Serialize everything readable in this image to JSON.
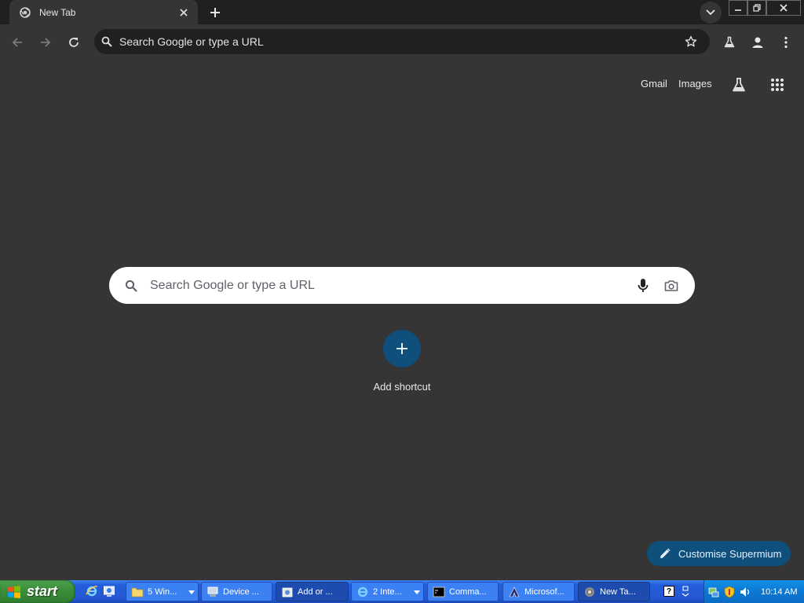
{
  "browser": {
    "tab": {
      "title": "New Tab",
      "favicon": "chrome-icon"
    },
    "omnibox": {
      "placeholder": "Search Google or type a URL"
    }
  },
  "page": {
    "top_links": {
      "gmail": "Gmail",
      "images": "Images"
    },
    "search": {
      "placeholder": "Search Google or type a URL"
    },
    "shortcut": {
      "label": "Add shortcut"
    },
    "customise": {
      "label": "Customise Supermium"
    }
  },
  "taskbar": {
    "start_label": "start",
    "buttons": [
      {
        "label": "5 Win...",
        "icon": "folder-icon",
        "grouped": true
      },
      {
        "label": "Device ...",
        "icon": "device-manager-icon",
        "grouped": false
      },
      {
        "label": "Add or ...",
        "icon": "add-remove-programs-icon",
        "grouped": false
      },
      {
        "label": "2 Inte...",
        "icon": "ie-icon",
        "grouped": true
      },
      {
        "label": "Comma...",
        "icon": "cmd-icon",
        "grouped": false
      },
      {
        "label": "Microsof...",
        "icon": "visual-studio-icon",
        "grouped": false
      },
      {
        "label": "New Ta...",
        "icon": "chrome-icon",
        "grouped": false
      }
    ],
    "clock": "10:14 AM"
  },
  "colors": {
    "frame": "#202020",
    "page_bg": "#353535",
    "accent": "#0e4f7c",
    "taskbar_blue": "#245edb",
    "start_green": "#3c8f3c"
  }
}
